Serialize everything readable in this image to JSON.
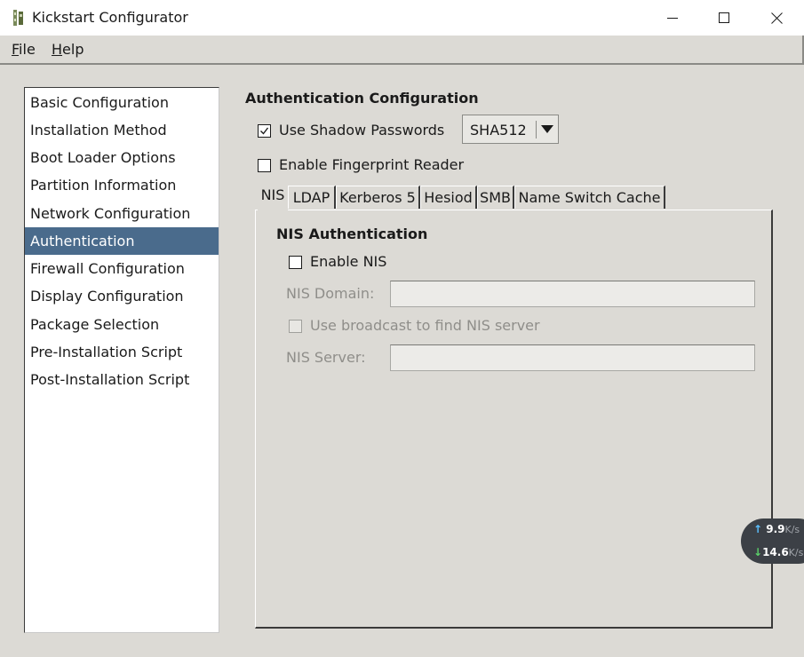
{
  "window": {
    "title": "Kickstart Configurator"
  },
  "menu": {
    "file": {
      "mnemonic": "F",
      "rest": "ile"
    },
    "help": {
      "mnemonic": "H",
      "rest": "elp"
    }
  },
  "nav": {
    "items": [
      {
        "label": "Basic Configuration"
      },
      {
        "label": "Installation Method"
      },
      {
        "label": "Boot Loader Options"
      },
      {
        "label": "Partition Information"
      },
      {
        "label": "Network Configuration"
      },
      {
        "label": "Authentication",
        "selected": true
      },
      {
        "label": "Firewall Configuration"
      },
      {
        "label": "Display Configuration"
      },
      {
        "label": "Package Selection"
      },
      {
        "label": "Pre-Installation Script"
      },
      {
        "label": "Post-Installation Script"
      }
    ]
  },
  "auth": {
    "title": "Authentication Configuration",
    "shadow": {
      "label": "Use Shadow Passwords",
      "checked": true
    },
    "hash": {
      "selected": "SHA512"
    },
    "fingerprint": {
      "label": "Enable Fingerprint Reader",
      "checked": false
    }
  },
  "tabs": [
    {
      "label": "NIS",
      "active": true
    },
    {
      "label": "LDAP"
    },
    {
      "label": "Kerberos 5"
    },
    {
      "label": "Hesiod"
    },
    {
      "label": "SMB"
    },
    {
      "label": "Name Switch Cache"
    }
  ],
  "nis": {
    "title": "NIS Authentication",
    "enable": {
      "label": "Enable NIS",
      "checked": false
    },
    "domain": {
      "label": "NIS Domain:",
      "value": ""
    },
    "broadcast": {
      "label": "Use broadcast to find NIS server",
      "checked": false
    },
    "server": {
      "label": "NIS Server:",
      "value": ""
    }
  },
  "network_widget": {
    "up_value": "9.9",
    "up_unit": "K/s",
    "down_value": "14.6",
    "down_unit": "K/s"
  },
  "colors": {
    "selection": "#4a6b8c",
    "background": "#dcdad5"
  }
}
